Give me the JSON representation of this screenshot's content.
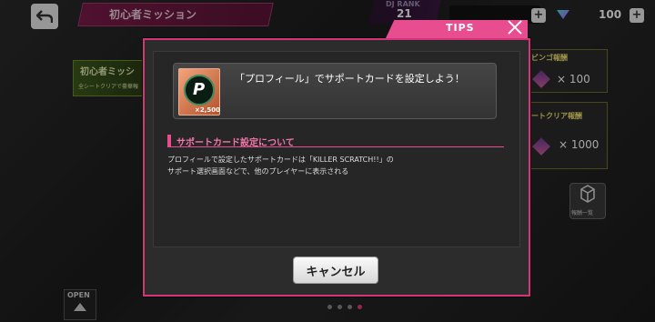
{
  "header": {
    "mission_title": "初心者ミッション",
    "dj_rank_label": "DJ RANK",
    "dj_rank_value": "21",
    "gem_value": "100",
    "plus": "+"
  },
  "left_banner": {
    "title": "初心者ミッシ",
    "subtitle": "全シートクリアで豪華報"
  },
  "rewards": {
    "bingo_header": "ビンゴ報酬",
    "bingo_value": "× 100",
    "sheet_header": "ートクリア報酬",
    "sheet_value": "× 1000",
    "reward_list_label": "報酬一覧"
  },
  "open_label": "OPEN",
  "modal": {
    "tab_label": "TIPS",
    "mission_text": "「プロフィール」でサポートカードを設定しよう！",
    "card_count": "×2,500",
    "card_letter": "P",
    "section_title": "サポートカード設定について",
    "desc_line1": "プロフィールで設定したサポートカードは「KILLER SCRATCH!!」の",
    "desc_line2": "サポート選択画面などで、他のプレイヤーに表示される",
    "cancel_label": "キャンセル"
  },
  "pager": {
    "count": 4,
    "active_index": 3
  },
  "colors": {
    "accent": "#e84d8f",
    "modal_border": "#d6337a",
    "mission_banner": "#7a1b49"
  }
}
